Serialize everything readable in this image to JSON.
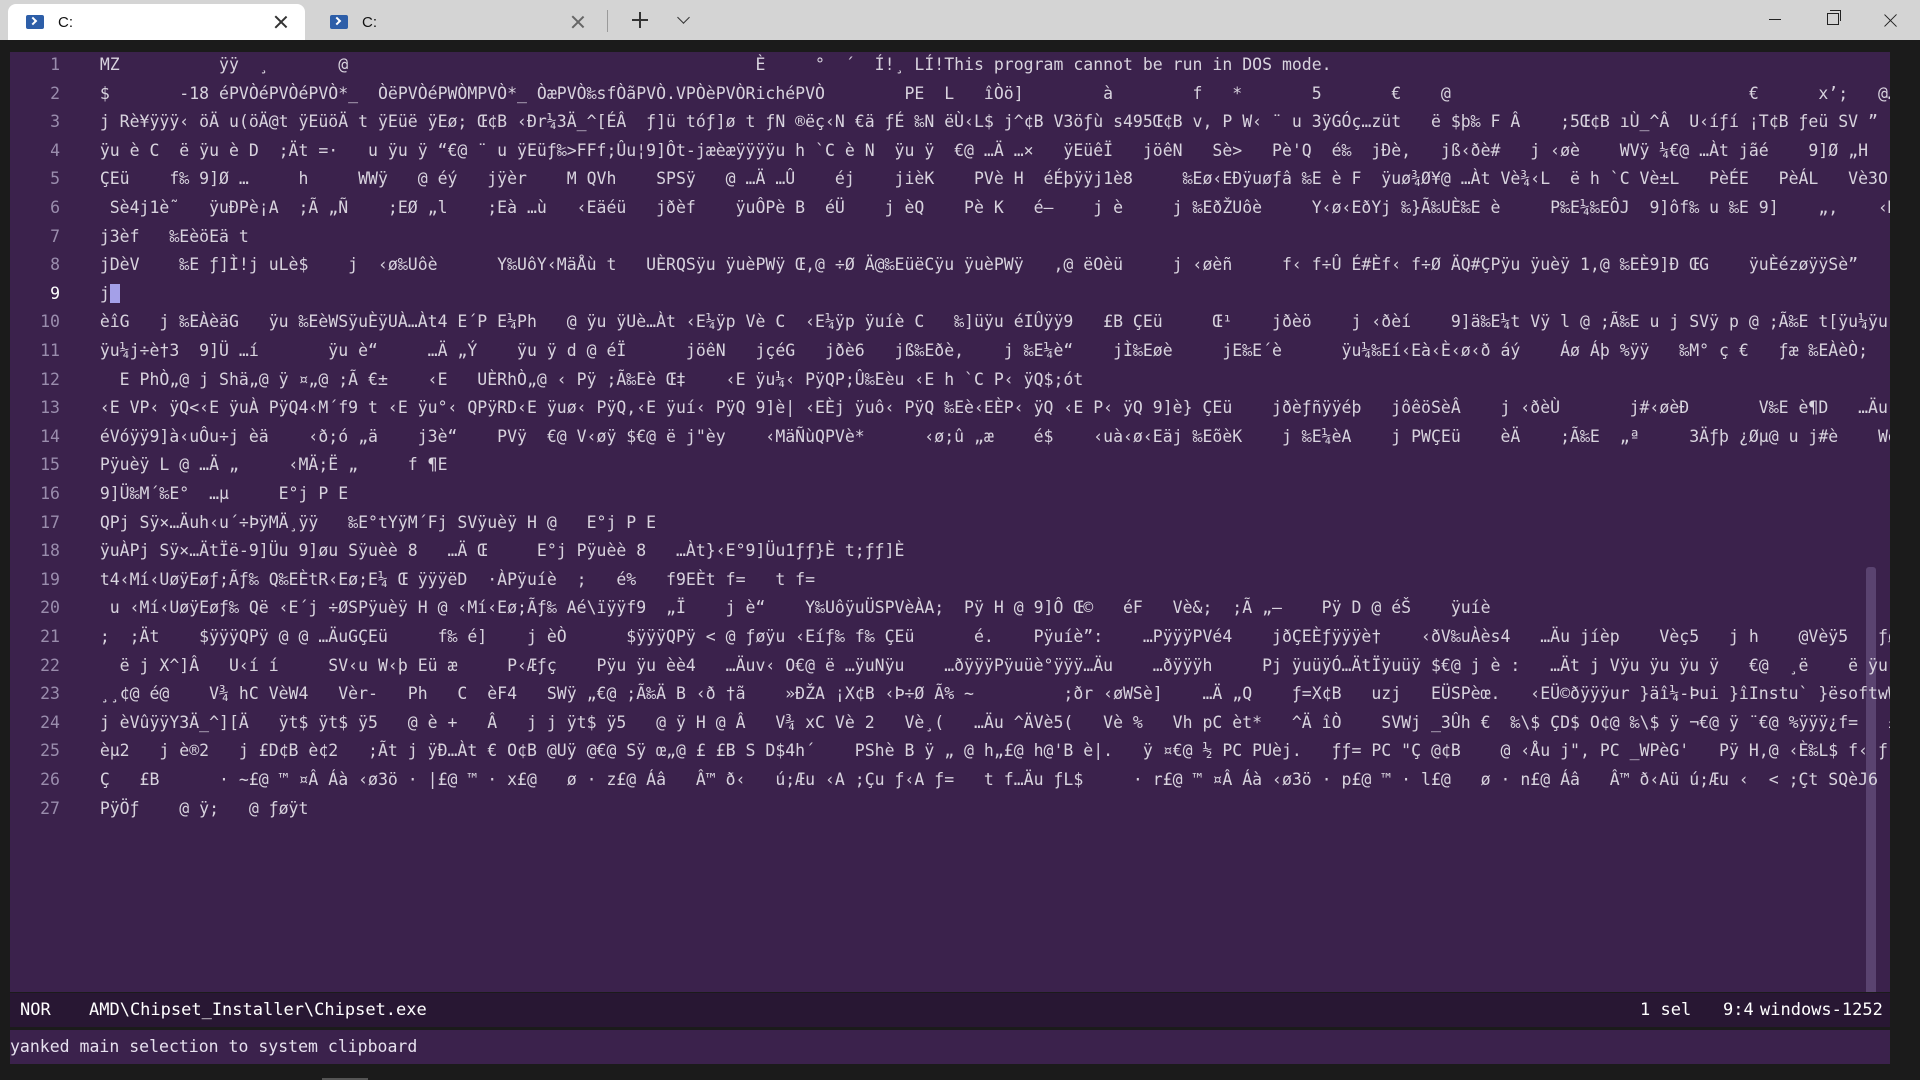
{
  "window": {
    "tabs": [
      {
        "title": "C:",
        "active": true,
        "icon": "powershell-icon"
      },
      {
        "title": "C:",
        "active": false,
        "icon": "powershell-icon"
      }
    ],
    "controls": [
      "minimize-icon",
      "maximize-icon",
      "close-icon"
    ]
  },
  "colors": {
    "editor_bg": "#3b224c",
    "statusline_bg": "#281733",
    "titlebar_bg": "#d4d4d4",
    "cursor_bg": "#a4a0e8"
  },
  "editor": {
    "lines": [
      {
        "n": "1",
        "text": "MZ          ÿÿ  ¸       @                                         È     °  ´  Í!¸ LÍ!This program cannot be run in DOS mode."
      },
      {
        "n": "2",
        "text": "$       -18 éPVÒéPVÒéPVÒ*_  ÒëPVÒéPWÒMPVÒ*_ ÒæPVÒ‰sfÒãPVÒ.VPÒèPVÒRichéPVÒ        PE  L   îÒö]        à        f   *       5       €    @                              €      x’;   @…"
      },
      {
        "n": "3",
        "text": "j Rè¥ÿÿÿ‹ öÄ u(öÄ@t ÿEüöÄ t ÿEüë ÿEø; Œ¢B ‹Ðr¼3Ä_^[ÉÂ  ƒ]ü tóƒ]ø t ƒN ®ëç‹N €ä ƒÉ ‰N ëÙ‹L$ j^¢B V3öƒù s495Œ¢B v, P W‹ ¨ u 3ÿGÓç…züt   ë $þ‰ F Â    ;5Œ¢B ıÙ_^Â  U‹íƒí ¡T¢B ƒeü SV ”"
      },
      {
        "n": "4",
        "text": "ÿu è C  ë ÿu è D  ;Ät =·   u ÿu ÿ “€@ ¨ u ÿEüƒ‰>FFf;Ûu¦9]Ôt-jæèæÿÿÿÿu h `C è N  ÿu ÿ  €@ …Ä …×   ÿEüêÏ   jöêN   Sè>   Pè'Q  é‰  jÐè,   jß‹ðè#   j ‹øè    WVÿ ¼€@ …Àt jãé    9]Ø „H"
      },
      {
        "n": "5",
        "text": "ÇEü    f‰ 9]Ø …     h     WWÿ   @ éý   jÿèr    M QVh    SPSÿ   @ …Ä …Û    éj    jièK    PVè H  éÉþÿÿj1è8     ‰Eø‹EÐÿuøƒâ ‰E è F  ÿuø¾Ø¥@ …Àt Vè¾‹L  ë h `C Vè±L   PèÉE   PèÁL   Vè3O   ƒ}   |1VèÕO"
      },
      {
        "n": "6",
        "text": " Sè4j1è˜   ÿuÐPè¡A  ;Ã „Ñ    ;EØ „l    ;Eà …ù   ‹Eäéü   jðèf    ÿuÔPè B  éÜ    j èQ    Pè K   é—    j è     j ‰EðŽUôè     Y‹ø‹EðYj ‰}Ã‰UÈ‰E è     P‰E¼‰EÔJ  9]ôf‰ u ‰E 9]    „,    ‹MÄ;Ë]   < ;û Œp"
      },
      {
        "n": "7",
        "text": "j3èf   ‰EèöEä t"
      },
      {
        "n": "8",
        "text": "jDèV    ‰E ƒ]Ì!j uLè$    j  ‹ø‰Uôè      Y‰UôY‹MäÅù t   UÈRQSÿu ÿuèPWÿ Œ,@ ÷Ø Ä@‰EüëCÿu ÿuèPWÿ   ,@ ëOèü     j ‹øèñ     f‹ f÷Û É#Èf‹ f÷Ø ÄQ#ÇPÿu ÿuèÿ 1,@ ‰EÈ9]Ð ŒG    ÿuÈézøÿÿSè”    Y‰UôPÿ p,@ …Ä"
      },
      {
        "n": "9",
        "text": "j",
        "cursor": true
      },
      {
        "n": "10",
        "text": "èîG   j ‰EÀèäG   ÿu ‰EèWSÿuÈÿUÀ…Àt4 E´P E¼Ph   @ ÿu ÿUè…Àt ‹E¼ÿp Vè C  ‹E¼ÿp ÿuíè C   ‰]üÿu éIÛÿÿ9   £B ÇEü     Œ¹    jðèö    j ‹ðèí    9]ä‰E¼t Vÿ l @ ;Ã‰E u j SVÿ p @ ;Ã‰E t[ÿu¼ÿu è°G  ‹ð;"
      },
      {
        "n": "11",
        "text": "ÿu¼j÷è†3  9]Ü …í       ÿu è“     …Ä „Ý    ÿu ÿ d @ éÏ      jöêN   jçéG   jðè6   jß‰Eðè,    j ‰E¼è“    jÌ‰Eøè     jE‰E´è      ÿu¼‰Eí‹Eà‹È‹ø‹ð áý    Áø Áþ %ÿÿ   ‰M° ç €   ƒæ ‰EÀèÒ;   …Äu j!èÏ"
      },
      {
        "n": "12",
        "text": "  E PhÒ„@ j Shä„@ ÿ ¤„@ ;Ã €±    ‹E   UÈRhÒ„@ ‹ Pÿ ;Ã‰Eè Œ‡    ‹E ÿu¼‹ PÿQP;Û‰Eèu ‹E h `C P‹ ÿQ$;ót"
      },
      {
        "n": "13",
        "text": "‹E VP‹ ÿQ<‹E ÿuÀ PÿQ4‹M´f9 t ‹E ÿu°‹ QPÿRD‹E ÿuø‹ PÿQ,‹E ÿuí‹ PÿQ 9]è| ‹EÈj ÿuô‹ PÿQ ‰Eè‹EÈP‹ ÿQ ‹E P‹ ÿQ 9]è} ÇEü    jðèƒñÿÿéþ   jôêöSèÂ    j ‹ðèÙ       j#‹øèÐ       V‰E è¶D   …Äu Sj"
      },
      {
        "n": "14",
        "text": "éVóÿÿ9]à‹uÔu÷j èä    ‹ð;ó „ä    j3è“    PVÿ  €@ V‹øÿ $€@ ë j\"èy    ‹MäÑùQPVè*      ‹ø;û „æ    é$    ‹uà‹ø‹Eäj ‰EõèK    j ‰E¼èA    j PWÇEü    èÄ    ;Ã‰E  „ª     3Äƒþ ¿Øµ@ u j#è    WèÏ?    D  ƒþ u"
      },
      {
        "n": "15",
        "text": "Pÿuèÿ L @ …Ä „     ‹MÄ;Ë „     f ¶E"
      },
      {
        "n": "16",
        "text": "9]Ü‰M´‰E°  …µ     E°j P E"
      },
      {
        "n": "17",
        "text": "QPj Sÿ×…Äuh‹u´÷ÞÿMÄ¸ÿÿ   ‰E°tYÿM´Fj SVÿuèÿ H @   E°j P E"
      },
      {
        "n": "18",
        "text": "ÿuÀPj Sÿ×…ÄtÏë-9]Üu 9]øu Sÿuèè 8   …Ä Œ     E°j Pÿuèè 8   …Àt}‹E°9]Üu1ƒƒ}È t;ƒƒ]È"
      },
      {
        "n": "19",
        "text": "t4‹Mí‹UøÿEøƒ;Ãƒ‰ Q‰EÈtR‹Eø;E¼ Œ ÿÿÿëD  ·ÀPÿuíè  ;   é%   f9EÈt f=   t f="
      },
      {
        "n": "20",
        "text": " u ‹Mí‹UøÿEøƒ‰ Që ‹E´j ÷ØSPÿuèÿ H @ ‹Mí‹Eø;Ãƒ‰ Aé\\ïÿÿf9  „Ï    j è“    Y‰UôÿuÜSPVèÀA;  Pÿ H @ 9]Ô Œ©   éF   Vè&;  ;Ã „–    Pÿ D @ éŠ    ÿuíè"
      },
      {
        "n": "21",
        "text": ";  ;Ät    $ÿÿÿQPÿ @ @ …ÄuGÇEü     f‰ é]    j èÒ      $ÿÿÿQPÿ < @ ƒøÿu ‹Eíƒ‰ f‰ ÇEü      é.    Pÿuíè”:    …PÿÿÿPVé4    jðÇEÈƒÿÿÿè†    ‹ðV‰uÀès4   …Äu jíèp    Vèç5   j h    @Vèÿ5   ƒøÿ‰E   „—    ¡X¢B"
      },
      {
        "n": "22",
        "text": "  ë j X^]Â   U‹í í     SV‹u W‹þ Eü æ     P‹Æƒç    Pÿu ÿu èè4   …Äuv‹ O€@ ë …ÿuNÿu    …ðÿÿÿPÿuüè°ÿÿÿ…Äu    …ðÿÿÿh     Pj ÿuüÿÓ…ÄtÏÿuüÿ $€@ j è :   …Ät j Vÿu ÿu ÿu ÿ   €@  ¸ë    ë ÿu ÿu ÿ   €@"
      },
      {
        "n": "23",
        "text": "¸¸¢@ é@    V¾ hC VèW4   Vèr-   Ph   C  èF4   SWÿ „€@ ;Ã‰Ä B ‹ð †ã    »ÐŽA ¡X¢B ‹Þ÷Ø Ã% ~         ;ðr ‹øWSè]    …Ä „Q    ƒ=X¢B   uzj   EÜSPèœ.   ‹EÜ©ðÿÿÿur }äî¼-Þui }îInstu` }ësoftwW }äNulluN     E"
      },
      {
        "n": "24",
        "text": "j èVûÿÿY3Ä_^][Ä   ÿt$ ÿt$ ÿ5   @ è +   Â   j j ÿt$ ÿ5   @ ÿ H @ Â   V¾ xC Vè 2   Vè¸(   …Äu ^ÄVè5(   Vè %   Vh pC èt*   ^Ä îÒ    SVWj _3Ûh €  ‰\\$ ÇD$ O¢@ ‰\\$ ÿ ¬€@ ÿ ¨€@ %ÿÿÿ¿f=   £L¢B t Sèâ2   ;"
      },
      {
        "n": "25",
        "text": "èµ2   j è®2   j £D¢B è¢2   ;Ãt j ÿÐ…Àt € O¢B @Uÿ @€@ Sÿ œ„@ £ £B S D$4h´    PShè B ÿ „ @ h„£@ h@'B è|.   ÿ ¤€@ ½ PC PUèj.   ƒƒ= PC \"Ç @¢B    @ ‹Åu j\", PC _WPèG'   Pÿ H,@ ‹È‰L$ f‹ ƒ;Ä „    j"
      },
      {
        "n": "26",
        "text": "Ç   £B      · ~£@ ™ ¤Â Áà ‹ø3ö · |£@ ™ · x£@   ø · z£@ Áâ   Â™ ð‹   ú;Æu ‹A ;Çu ƒ‹A ƒ=   t f…Äu ƒL$     · r£@ ™ ¤Â Áà ‹ø3ö · p£@ ™ · l£@   ø · n£@ Áâ   Â™ ð‹Aü ú;Æu ‹  < ;Çt SQèJ6   ‹Èƒƒ9\"u AAƒ‹"
      },
      {
        "n": "27",
        "text": "PÿÖƒ    @ ÿ;   @ ƒøÿt"
      }
    ]
  },
  "statusline": {
    "mode": "NOR",
    "file": "AMD\\Chipset_Installer\\Chipset.exe",
    "selections": "1 sel",
    "position": "9:4",
    "encoding": "windows-1252"
  },
  "message": "yanked main selection to system clipboard"
}
